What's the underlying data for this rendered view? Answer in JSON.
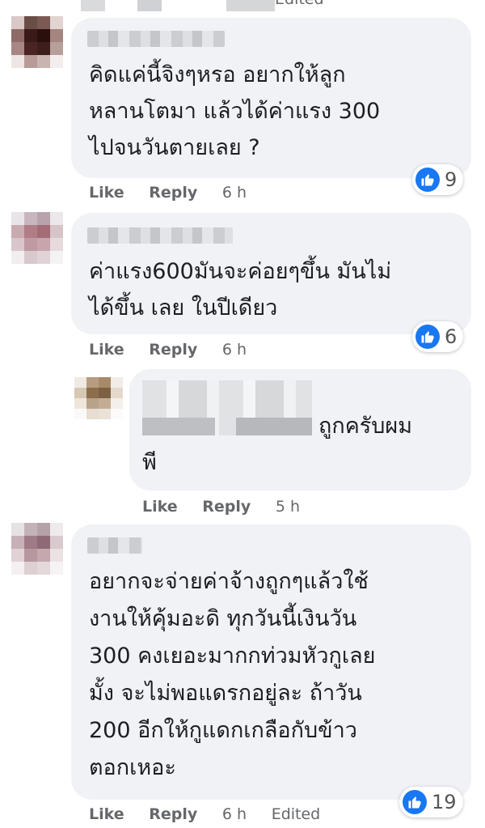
{
  "comments": [
    {
      "text": "คิดแค่นี้จิงๆหรอ อยากให้ลูก\nหลานโตมา แล้วได้ค่าแรง 300\nไปจนวันตายเลย ?",
      "like": "Like",
      "reply": "Reply",
      "time": "6 h",
      "reactions": "9"
    },
    {
      "text": "ค่าแรง600มันจะค่อยๆขึ้น มันไม่\nได้ขึ้น เลย ในปีเดียว",
      "like": "Like",
      "reply": "Reply",
      "time": "6 h",
      "reactions": "6"
    },
    {
      "text_a": "ถูกครับผม",
      "text_b": "พี",
      "like": "Like",
      "reply": "Reply",
      "time": "5 h"
    },
    {
      "text": "อยากจะจ่ายค่าจ้างถูกๆแล้วใช้\nงานให้คุ้มอะดิ ทุกวันนี้เงินวัน\n300 คงเยอะมากกท่วมหัวกูเลย\nมั้ง จะไม่พอแดรกอยู่ละ ถ้าวัน\n200 อีกให้กูแดกเกลือกับข้าว\nตอกเหอะ",
      "like": "Like",
      "reply": "Reply",
      "time": "6 h",
      "edited": "Edited",
      "reactions": "19"
    }
  ],
  "top_edited": "Edited",
  "colors": {
    "bubble": "#f0f2f5",
    "like_blue": "#1877f2",
    "meta": "#65676b"
  }
}
